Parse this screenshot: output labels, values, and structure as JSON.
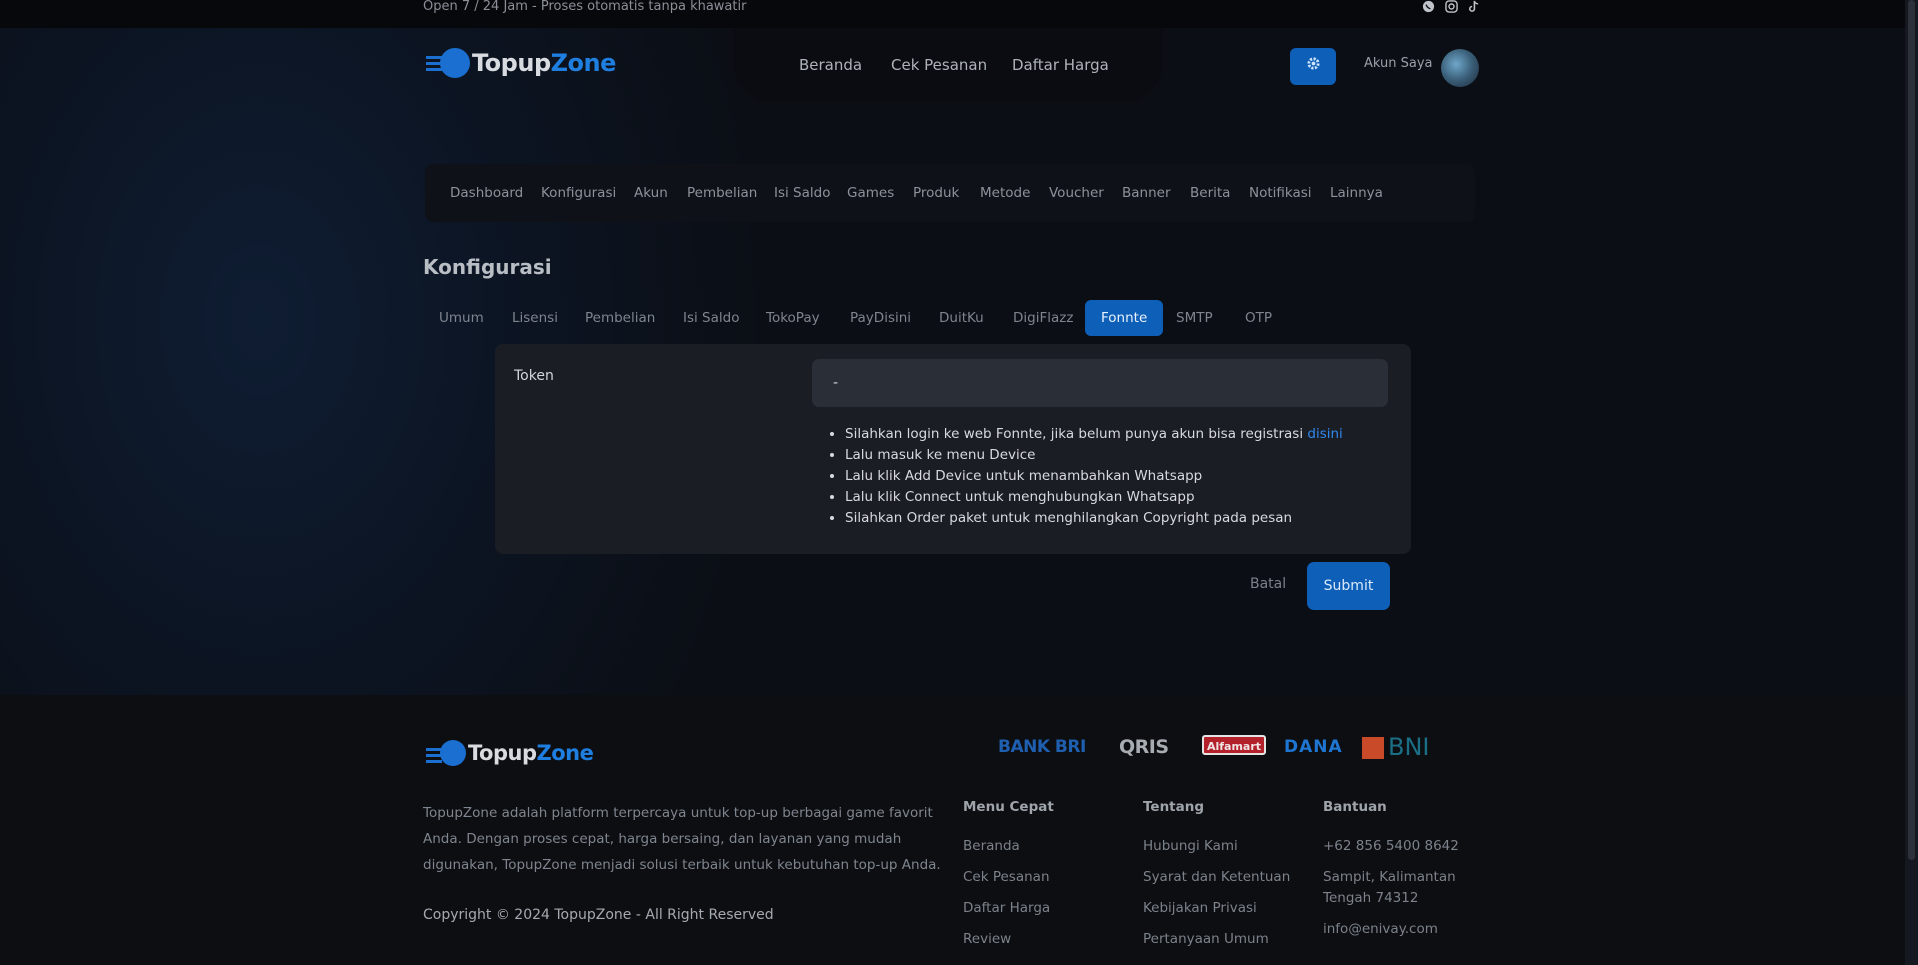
{
  "topbar": {
    "text": "Open 7 / 24 Jam - Proses otomatis tanpa khawatir",
    "icons": [
      "whatsapp-icon",
      "instagram-icon",
      "tiktok-icon"
    ]
  },
  "brand": {
    "part1": "Topup",
    "part2": "Zone"
  },
  "nav": {
    "home": "Beranda",
    "check_order": "Cek Pesanan",
    "price_list": "Daftar Harga"
  },
  "account": {
    "label": "Akun Saya"
  },
  "admin_menu": [
    "Dashboard",
    "Konfigurasi",
    "Akun",
    "Pembelian",
    "Isi Saldo",
    "Games",
    "Produk",
    "Metode",
    "Voucher",
    "Banner",
    "Berita",
    "Notifikasi",
    "Lainnya"
  ],
  "page": {
    "title": "Konfigurasi"
  },
  "tabs": [
    "Umum",
    "Lisensi",
    "Pembelian",
    "Isi Saldo",
    "TokoPay",
    "PayDisini",
    "DuitKu",
    "DigiFlazz",
    "Fonnte",
    "SMTP",
    "OTP"
  ],
  "active_tab": "Fonnte",
  "form": {
    "token_label": "Token",
    "token_value": "-",
    "instructions": {
      "line1": "Silahkan login ke web Fonnte, jika belum punya akun bisa registrasi",
      "line1_link": "disini",
      "line2": "Lalu masuk ke menu Device",
      "line3": "Lalu klik Add Device untuk menambahkan Whatsapp",
      "line4": "Lalu klik Connect untuk menghubungkan Whatsapp",
      "line5": "Silahkan Order paket untuk menghilangkan Copyright pada pesan"
    },
    "cancel_label": "Batal",
    "submit_label": "Submit"
  },
  "footer": {
    "payments": {
      "bri": "BANK BRI",
      "qris": "QRIS",
      "alfamart": "Alfamart",
      "dana": "DANA",
      "bni": "BNI"
    },
    "about": "TopupZone adalah platform terpercaya untuk top-up berbagai game favorit Anda. Dengan proses cepat, harga bersaing, dan layanan yang mudah digunakan, TopupZone menjadi solusi terbaik untuk kebutuhan top-up Anda.",
    "copyright": "Copyright © 2024 TopupZone - All Right Reserved",
    "menu_cepat": {
      "title": "Menu Cepat",
      "items": [
        "Beranda",
        "Cek Pesanan",
        "Daftar Harga",
        "Review"
      ]
    },
    "tentang": {
      "title": "Tentang",
      "items": [
        "Hubungi Kami",
        "Syarat dan Ketentuan",
        "Kebijakan Privasi",
        "Pertanyaan Umum"
      ]
    },
    "bantuan": {
      "title": "Bantuan",
      "phone": "+62 856 5400 8642",
      "address_line1": "Sampit, Kalimantan",
      "address_line2": "Tengah 74312",
      "email": "info@enivay.com"
    }
  },
  "colors": {
    "accent": "#0d5fb8",
    "link": "#2f88ef",
    "background": "#0b0d12",
    "panel": "#1a1d24"
  }
}
